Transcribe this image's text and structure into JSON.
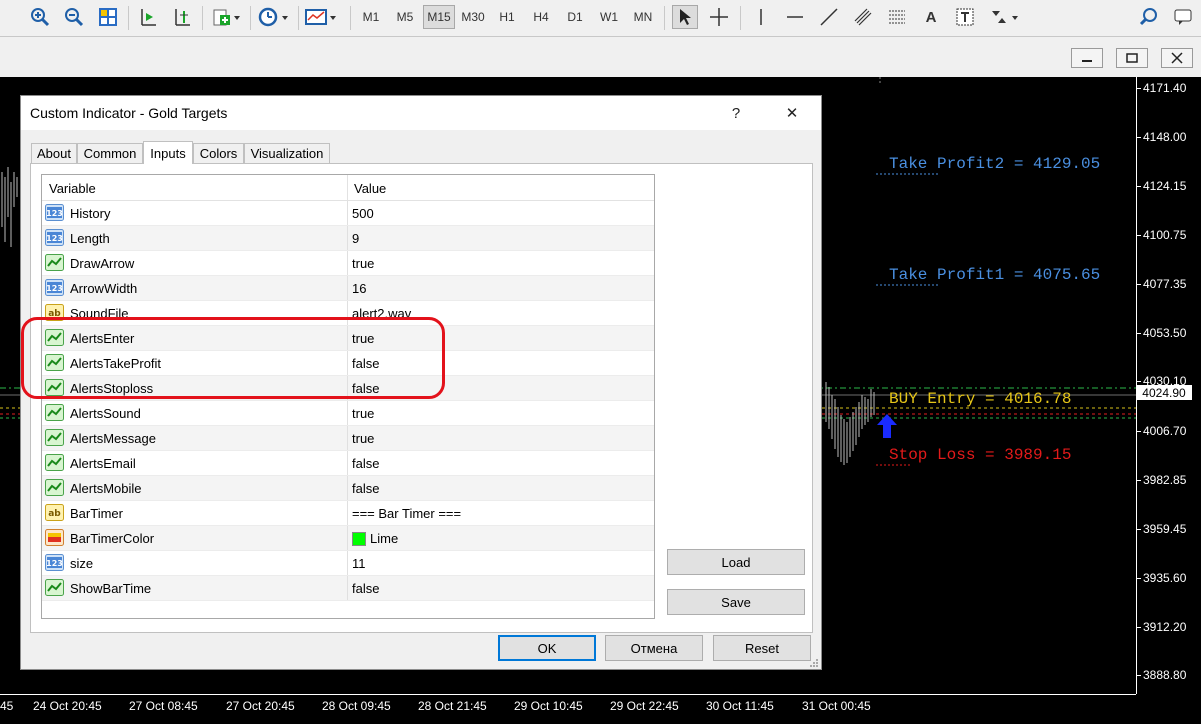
{
  "toolbar": {
    "timeframes": [
      "M1",
      "M5",
      "M15",
      "M30",
      "H1",
      "H4",
      "D1",
      "W1",
      "MN"
    ],
    "active_timeframe": "M15"
  },
  "chart": {
    "price_labels": [
      "4171.40",
      "4148.00",
      "4124.15",
      "4100.75",
      "4077.35",
      "4053.50",
      "4030.10",
      "4006.70",
      "3982.85",
      "3959.45",
      "3935.60",
      "3912.20",
      "3888.80"
    ],
    "current_price": "4024.90",
    "time_labels": [
      "24 Oct 20:45",
      "27 Oct 08:45",
      "27 Oct 20:45",
      "28 Oct 09:45",
      "28 Oct 21:45",
      "29 Oct 10:45",
      "29 Oct 22:45",
      "30 Oct 11:45",
      "31 Oct 00:45"
    ],
    "edge_time_label": "45",
    "annotations": {
      "tp2": "Take Profit2 = 4129.05",
      "tp1": "Take Profit1 = 4075.65",
      "entry": "BUY Entry = 4016.78",
      "sl": "Stop Loss = 3989.15"
    },
    "colors": {
      "tp": "#4a8fe0",
      "entry": "#e6c619",
      "sl": "#e31a1a",
      "arrow": "#1a2bff"
    }
  },
  "dialog": {
    "title": "Custom Indicator - Gold Targets",
    "help": "?",
    "close": "✕",
    "tabs": [
      "About",
      "Common",
      "Inputs",
      "Colors",
      "Visualization"
    ],
    "active_tab": "Inputs",
    "columns": {
      "variable": "Variable",
      "value": "Value"
    },
    "rows": [
      {
        "icon": "int",
        "name": "History",
        "value": "500"
      },
      {
        "icon": "int",
        "name": "Length",
        "value": "9"
      },
      {
        "icon": "bool",
        "name": "DrawArrow",
        "value": "true"
      },
      {
        "icon": "int",
        "name": "ArrowWidth",
        "value": "16"
      },
      {
        "icon": "str",
        "name": "SoundFile",
        "value": "alert2.wav"
      },
      {
        "icon": "bool",
        "name": "AlertsEnter",
        "value": "true"
      },
      {
        "icon": "bool",
        "name": "AlertsTakeProfit",
        "value": "false"
      },
      {
        "icon": "bool",
        "name": "AlertsStoploss",
        "value": "false"
      },
      {
        "icon": "bool",
        "name": "AlertsSound",
        "value": "true"
      },
      {
        "icon": "bool",
        "name": "AlertsMessage",
        "value": "true"
      },
      {
        "icon": "bool",
        "name": "AlertsEmail",
        "value": "false"
      },
      {
        "icon": "bool",
        "name": "AlertsMobile",
        "value": "false"
      },
      {
        "icon": "str",
        "name": "BarTimer",
        "value": "=== Bar Timer ==="
      },
      {
        "icon": "color",
        "name": "BarTimerColor",
        "value": "Lime"
      },
      {
        "icon": "int",
        "name": "size",
        "value": "11"
      },
      {
        "icon": "bool",
        "name": "ShowBarTime",
        "value": "false"
      }
    ],
    "buttons": {
      "load": "Load",
      "save": "Save",
      "ok": "OK",
      "cancel": "Отмена",
      "reset": "Reset"
    }
  }
}
